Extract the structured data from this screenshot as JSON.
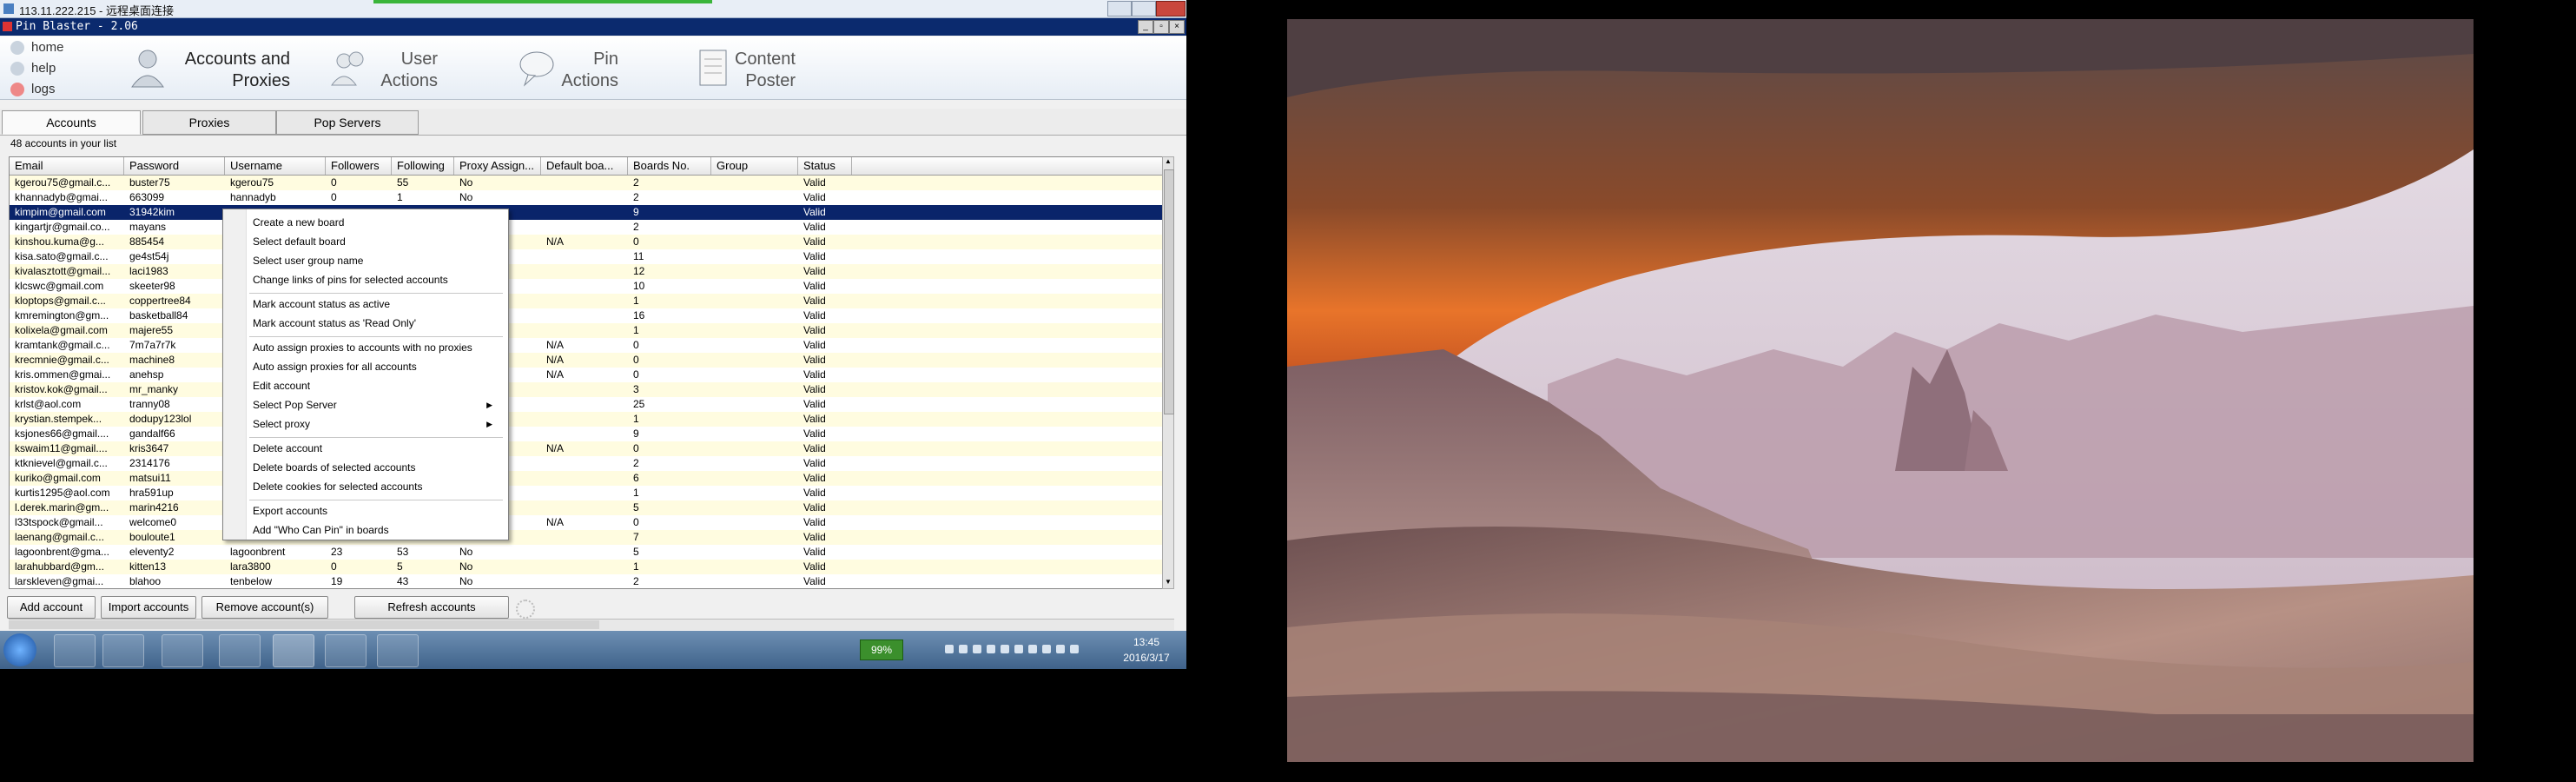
{
  "rdp_window": {
    "title": "113.11.222.215 - 远程桌面连接"
  },
  "app": {
    "title": "Pin Blaster - 2.06"
  },
  "side_links": [
    {
      "label": "home"
    },
    {
      "label": "help"
    },
    {
      "label": "logs"
    }
  ],
  "nav": {
    "accounts": {
      "line1": "Accounts and",
      "line2": "Proxies"
    },
    "user_actions": {
      "line1": "User",
      "line2": "Actions"
    },
    "pin_actions": {
      "line1": "Pin",
      "line2": "Actions"
    },
    "content_poster": {
      "line1": "Content",
      "line2": "Poster"
    }
  },
  "tabs": [
    {
      "label": "Accounts",
      "active": true
    },
    {
      "label": "Proxies"
    },
    {
      "label": "Pop Servers"
    }
  ],
  "account_count": "48 accounts in your list",
  "table": {
    "columns": [
      "Email",
      "Password",
      "Username",
      "Followers",
      "Following",
      "Proxy Assign...",
      "Default boa...",
      "Boards No.",
      "Group",
      "Status"
    ],
    "rows": [
      [
        "kgerou75@gmail.c...",
        "buster75",
        "kgerou75",
        "0",
        "55",
        "No",
        "",
        "2",
        "",
        "Valid"
      ],
      [
        "khannadyb@gmai...",
        "663099",
        "hannadyb",
        "0",
        "1",
        "No",
        "",
        "2",
        "",
        "Valid"
      ],
      [
        "kimpim@gmail.com",
        "31942kim",
        "",
        "",
        "",
        "",
        "",
        "9",
        "",
        "Valid"
      ],
      [
        "kingartjr@gmail.co...",
        "mayans",
        "",
        "",
        "",
        "",
        "",
        "2",
        "",
        "Valid"
      ],
      [
        "kinshou.kuma@g...",
        "885454",
        "",
        "",
        "",
        "",
        "N/A",
        "0",
        "",
        "Valid"
      ],
      [
        "kisa.sato@gmail.c...",
        "ge4st54j",
        "",
        "",
        "",
        "",
        "",
        "11",
        "",
        "Valid"
      ],
      [
        "kivalasztott@gmail...",
        "laci1983",
        "",
        "",
        "",
        "",
        "",
        "12",
        "",
        "Valid"
      ],
      [
        "klcswc@gmail.com",
        "skeeter98",
        "",
        "",
        "",
        "",
        "",
        "10",
        "",
        "Valid"
      ],
      [
        "kloptops@gmail.c...",
        "coppertree84",
        "",
        "",
        "",
        "",
        "",
        "1",
        "",
        "Valid"
      ],
      [
        "kmremington@gm...",
        "basketball84",
        "",
        "",
        "",
        "",
        "",
        "16",
        "",
        "Valid"
      ],
      [
        "kolixela@gmail.com",
        "majere55",
        "",
        "",
        "",
        "",
        "",
        "1",
        "",
        "Valid"
      ],
      [
        "kramtank@gmail.c...",
        "7m7a7r7k",
        "",
        "",
        "",
        "",
        "N/A",
        "0",
        "",
        "Valid"
      ],
      [
        "krecmnie@gmail.c...",
        "machine8",
        "",
        "",
        "",
        "",
        "N/A",
        "0",
        "",
        "Valid"
      ],
      [
        "kris.ommen@gmai...",
        "anehsp",
        "",
        "",
        "",
        "",
        "N/A",
        "0",
        "",
        "Valid"
      ],
      [
        "kristov.kok@gmail...",
        "mr_manky",
        "",
        "",
        "",
        "",
        "",
        "3",
        "",
        "Valid"
      ],
      [
        "krlst@aol.com",
        "tranny08",
        "",
        "",
        "",
        "",
        "",
        "25",
        "",
        "Valid"
      ],
      [
        "krystian.stempek...",
        "dodupy123lol",
        "",
        "",
        "",
        "",
        "",
        "1",
        "",
        "Valid"
      ],
      [
        "ksjones66@gmail....",
        "gandalf66",
        "",
        "",
        "",
        "",
        "",
        "9",
        "",
        "Valid"
      ],
      [
        "kswaim11@gmail....",
        "kris3647",
        "",
        "",
        "",
        "",
        "N/A",
        "0",
        "",
        "Valid"
      ],
      [
        "ktknievel@gmail.c...",
        "2314176",
        "",
        "",
        "",
        "",
        "",
        "2",
        "",
        "Valid"
      ],
      [
        "kuriko@gmail.com",
        "matsui11",
        "",
        "",
        "",
        "",
        "",
        "6",
        "",
        "Valid"
      ],
      [
        "kurtis1295@aol.com",
        "hra591up",
        "",
        "",
        "",
        "",
        "",
        "1",
        "",
        "Valid"
      ],
      [
        "l.derek.marin@gm...",
        "marin4216",
        "",
        "",
        "",
        "",
        "",
        "5",
        "",
        "Valid"
      ],
      [
        "l33tspock@gmail...",
        "welcome0",
        "",
        "",
        "",
        "",
        "N/A",
        "0",
        "",
        "Valid"
      ],
      [
        "laenang@gmail.c...",
        "bouloute1",
        "",
        "",
        "",
        "",
        "",
        "7",
        "",
        "Valid"
      ],
      [
        "lagoonbrent@gma...",
        "eleventy2",
        "lagoonbrent",
        "23",
        "53",
        "No",
        "",
        "5",
        "",
        "Valid"
      ],
      [
        "larahubbard@gm...",
        "kitten13",
        "lara3800",
        "0",
        "5",
        "No",
        "",
        "1",
        "",
        "Valid"
      ],
      [
        "larskleven@gmai...",
        "blahoo",
        "tenbelow",
        "19",
        "43",
        "No",
        "",
        "2",
        "",
        "Valid"
      ]
    ]
  },
  "context_menu": [
    {
      "label": "Create a new board"
    },
    {
      "label": "Select default board"
    },
    {
      "label": "Select user group name"
    },
    {
      "label": "Change links of pins for selected accounts"
    },
    {
      "label": "Mark account status as active"
    },
    {
      "label": "Mark account status as 'Read Only'"
    },
    {
      "label": "Auto assign proxies to accounts with no proxies"
    },
    {
      "label": "Auto assign proxies for all accounts"
    },
    {
      "label": "Edit account"
    },
    {
      "label": "Select Pop Server",
      "submenu": true
    },
    {
      "label": "Select proxy",
      "submenu": true
    },
    {
      "label": "Delete account"
    },
    {
      "label": "Delete boards of selected accounts"
    },
    {
      "label": "Delete cookies for selected accounts"
    },
    {
      "label": "Export accounts"
    },
    {
      "label": "Add \"Who Can Pin\" in boards"
    }
  ],
  "buttons": {
    "add_account": "Add account",
    "import_accounts": "Import accounts",
    "remove_accounts": "Remove account(s)",
    "refresh_accounts": "Refresh accounts"
  },
  "taskbar": {
    "battery": "99%",
    "time": "13:45",
    "date": "2016/3/17"
  },
  "colors": {
    "selection": "#0a246a",
    "row_alt": "#fffce0",
    "app_titlebar": "#0b2a6e"
  }
}
